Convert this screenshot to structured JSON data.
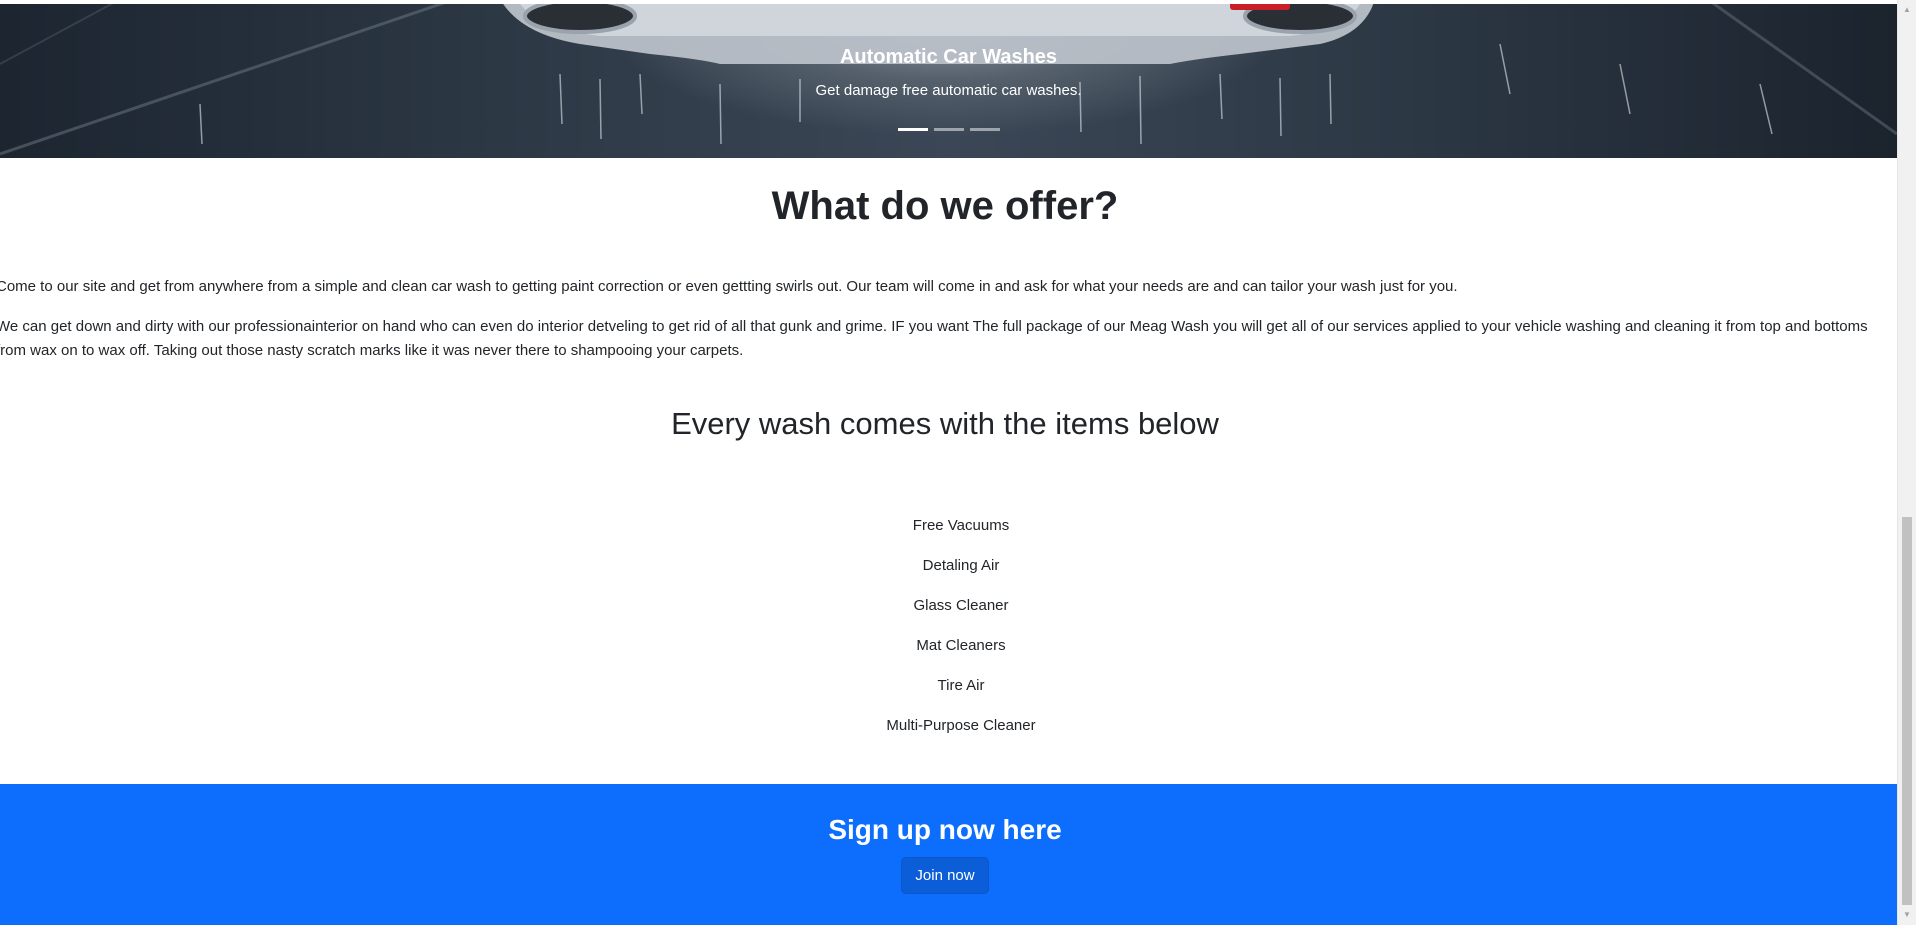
{
  "hero": {
    "title": "Automatic Car Washes",
    "subtitle": "Get damage free automatic car washes.",
    "indicators": [
      "slide-1",
      "slide-2",
      "slide-3"
    ],
    "active_indicator": 0
  },
  "offer": {
    "heading": "What do we offer?",
    "paragraph1": "Come to our site and get from anywhere from a simple and clean car wash to getting paint correction or even gettting swirls out. Our team will come in and ask for what your needs are and can tailor your wash just for you.",
    "paragraph2": "We can get down and dirty with our professionainterior on hand who can even do interior detveling to get rid of all that gunk and grime. IF you want The full package of our Meag Wash you will get all of our services applied to your vehicle washing and cleaning it from top and bottoms from wax on to wax off. Taking out those nasty scratch marks like it was never there to shampooing your carpets."
  },
  "wash": {
    "heading": "Every wash comes with the items below",
    "items": [
      "Free Vacuums",
      "Detaling Air",
      "Glass Cleaner",
      "Mat Cleaners",
      "Tire Air",
      "Multi-Purpose Cleaner"
    ]
  },
  "signup": {
    "heading": "Sign up now here",
    "button_label": "Join now"
  },
  "colors": {
    "signup_band": "#0d6efd",
    "join_button": "#0b5ed7",
    "text": "#212529"
  },
  "icons": {
    "scroll_up": "triangle-up-icon",
    "scroll_down": "triangle-down-icon"
  }
}
